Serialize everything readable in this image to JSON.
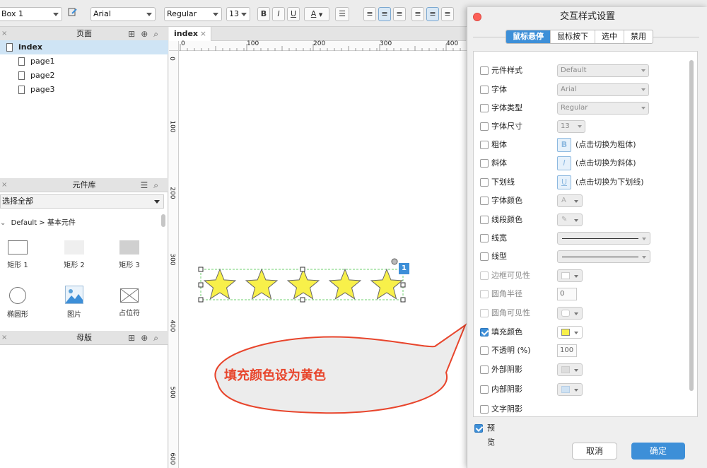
{
  "toolbar": {
    "element_name": "Box 1",
    "font_family": "Arial",
    "font_style": "Regular",
    "font_size": "13",
    "bold": "B",
    "italic": "I",
    "underline": "U",
    "font_color_letter": "A"
  },
  "pages_panel": {
    "title": "页面",
    "items": [
      "index",
      "page1",
      "page2",
      "page3"
    ]
  },
  "library_panel": {
    "title": "元件库",
    "filter_value": "选择全部",
    "group": "Default > 基本元件",
    "widgets": [
      "矩形 1",
      "矩形 2",
      "矩形 3",
      "椭圆形",
      "图片",
      "占位符"
    ]
  },
  "masters_panel": {
    "title": "母版"
  },
  "canvas": {
    "tab_label": "index",
    "tab_close": "×",
    "ruler_h": [
      "0",
      "100",
      "200",
      "300",
      "400"
    ],
    "ruler_v": [
      "0",
      "100",
      "200",
      "300",
      "400",
      "500",
      "600"
    ],
    "selection_badge": "1",
    "callout_text": "填充颜色设为黄色",
    "star_fill": "#f8f04a",
    "callout_border": "#e8452c",
    "callout_text_color": "#e8452c"
  },
  "dialog": {
    "title": "交互样式设置",
    "tabs": [
      "鼠标悬停",
      "鼠标按下",
      "选中",
      "禁用"
    ],
    "rows": [
      {
        "label": "元件样式",
        "value": "Default"
      },
      {
        "label": "字体",
        "value": "Arial"
      },
      {
        "label": "字体类型",
        "value": "Regular"
      },
      {
        "label": "字体尺寸",
        "value": "13"
      },
      {
        "label": "粗体",
        "hint": "(点击切换为粗体)",
        "glyph": "B"
      },
      {
        "label": "斜体",
        "hint": "(点击切换为斜体)",
        "glyph": "I"
      },
      {
        "label": "下划线",
        "hint": "(点击切换为下划线)",
        "glyph": "U"
      },
      {
        "label": "字体颜色"
      },
      {
        "label": "线段颜色"
      },
      {
        "label": "线宽"
      },
      {
        "label": "线型"
      },
      {
        "label": "边框可见性"
      },
      {
        "label": "圆角半径",
        "value": "0"
      },
      {
        "label": "圆角可见性"
      },
      {
        "label": "填充颜色",
        "checked": true,
        "swatch": "#f8f04a"
      },
      {
        "label": "不透明 (%)",
        "value": "100"
      },
      {
        "label": "外部阴影"
      },
      {
        "label": "内部阴影"
      },
      {
        "label": "文字阴影"
      }
    ],
    "preview_label": "预 览",
    "cancel_label": "取消",
    "ok_label": "确定"
  }
}
